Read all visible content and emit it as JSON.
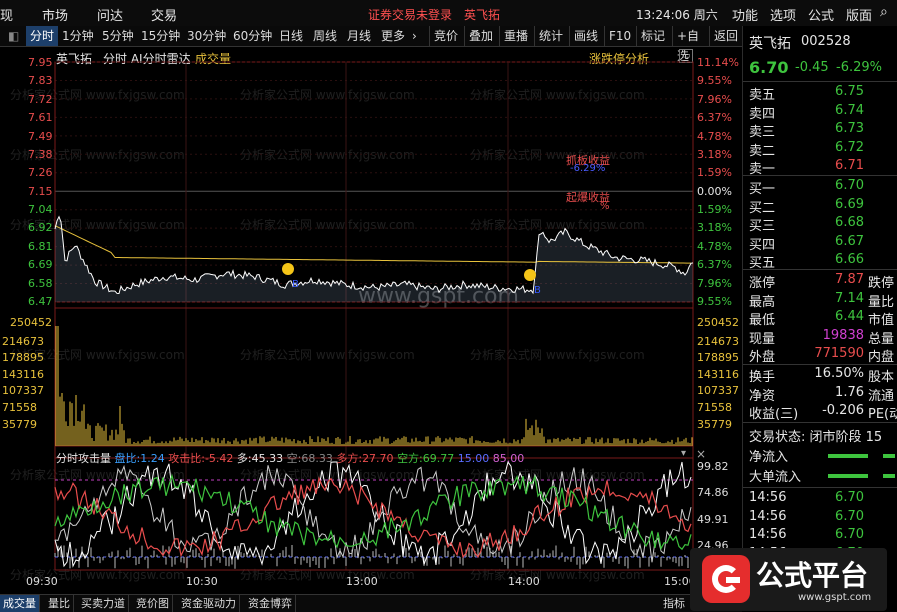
{
  "menu": {
    "left_items": [
      "现",
      "市场",
      "问达",
      "交易"
    ],
    "status_text": "证券交易未登录",
    "stock_title": "英飞拓",
    "clock": "13:24:06 周六",
    "right_items": [
      "功能",
      "选项",
      "公式",
      "版面"
    ]
  },
  "toolbar": {
    "periods": [
      "分时",
      "1分钟",
      "5分钟",
      "15分钟",
      "30分钟",
      "60分钟",
      "日线",
      "周线",
      "月线",
      "更多"
    ],
    "tools": [
      "竞价",
      "叠加",
      "重播",
      "统计",
      "画线",
      "F10",
      "标记",
      "+自选",
      "返回"
    ]
  },
  "chart_header": {
    "stock": "英飞拓",
    "title": "分时 AI分时雷达",
    "volume_label": "成交量",
    "limit_button": "涨跌停分析"
  },
  "colors": {
    "up": "#e84d4d",
    "down": "#3ec43e",
    "price_line": "#ffffff",
    "avg_line": "#e8c23c",
    "bg": "#000000"
  },
  "price_axis": [
    "7.95",
    "7.83",
    "7.72",
    "7.61",
    "7.49",
    "7.38",
    "7.26",
    "7.15",
    "7.04",
    "6.92",
    "6.81",
    "6.69",
    "6.58",
    "6.47"
  ],
  "pct_axis": [
    "11.14%",
    "9.55%",
    "7.96%",
    "6.37%",
    "4.78%",
    "3.18%",
    "1.59%",
    "0.00%",
    "1.59%",
    "3.18%",
    "4.78%",
    "6.37%",
    "7.96%",
    "9.55%"
  ],
  "volume_axis": [
    "250452",
    "214673",
    "178895",
    "143116",
    "107337",
    "71558",
    "35779"
  ],
  "annotations": {
    "a1": "抓板收益",
    "a2": "-6.29%",
    "b1": "起爆收益",
    "b2": "%"
  },
  "indicator": {
    "name": "分时攻击量",
    "pan_label": "盘比:",
    "pan_value": "1.24",
    "attack_label": "攻击比:",
    "attack_value": "-5.42",
    "duo_label": "多:",
    "duo_value": "45.33",
    "kong_label": "空:",
    "kong_value": "68.33",
    "duofang_label": "多方:",
    "duofang_value": "27.70",
    "kongfang_label": "空方:",
    "kongfang_value": "69.77",
    "v15": "15.00",
    "v85": "85.00",
    "axis": [
      "99.82",
      "74.86",
      "49.91",
      "24.96"
    ]
  },
  "time_axis": [
    "09:30",
    "10:30",
    "13:00",
    "14:00",
    "15:00"
  ],
  "bottom_tabs": [
    "成交量",
    "量比",
    "买卖力道",
    "竞价图",
    "资金驱动力",
    "资金博弈",
    "指标"
  ],
  "watermark": {
    "site": "www.gspt.com",
    "text": "分析家公式网 www.fxjgsw.com"
  },
  "quote": {
    "name": "英飞拓",
    "code": "002528",
    "price": "6.70",
    "change": "-0.45",
    "change_pct": "-6.29%",
    "asks": [
      {
        "label": "卖五",
        "price": "6.75"
      },
      {
        "label": "卖四",
        "price": "6.74"
      },
      {
        "label": "卖三",
        "price": "6.73"
      },
      {
        "label": "卖二",
        "price": "6.72"
      },
      {
        "label": "卖一",
        "price": "6.71"
      }
    ],
    "bids": [
      {
        "label": "买一",
        "price": "6.70"
      },
      {
        "label": "买二",
        "price": "6.69"
      },
      {
        "label": "买三",
        "price": "6.68"
      },
      {
        "label": "买四",
        "price": "6.67"
      },
      {
        "label": "买五",
        "price": "6.66"
      }
    ],
    "stats": [
      {
        "label": "涨停",
        "value": "7.87",
        "label2": "跌停"
      },
      {
        "label": "最高",
        "value": "7.14",
        "label2": "量比"
      },
      {
        "label": "最低",
        "value": "6.44",
        "label2": "市值"
      },
      {
        "label": "现量",
        "value": "19838",
        "label2": "总量"
      },
      {
        "label": "外盘",
        "value": "771590",
        "label2": "内盘"
      }
    ],
    "stats2": [
      {
        "label": "换手",
        "value": "16.50%",
        "label2": "股本"
      },
      {
        "label": "净资",
        "value": "1.76",
        "label2": "流通"
      },
      {
        "label": "收益(三)",
        "value": "-0.206",
        "label2": "PE(动"
      }
    ],
    "trade_status": "交易状态: 闭市阶段 15",
    "net_inflow": "净流入",
    "big_inflow": "大单流入",
    "ticks": [
      {
        "time": "14:56",
        "price": "6.70"
      },
      {
        "time": "14:56",
        "price": "6.70"
      },
      {
        "time": "14:56",
        "price": "6.70"
      },
      {
        "time": "14:56",
        "price": "6.70"
      }
    ]
  },
  "logo": {
    "text": "公式平台",
    "sub": "www.gspt.com"
  }
}
